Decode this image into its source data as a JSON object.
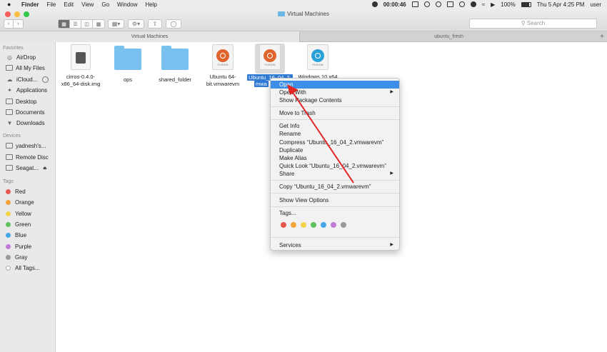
{
  "menubar": {
    "apple": "",
    "app": "Finder",
    "items": [
      "File",
      "Edit",
      "View",
      "Go",
      "Window",
      "Help"
    ],
    "recording_time": "00:00:46",
    "battery": "100%",
    "datetime": "Thu 5 Apr  4:25 PM",
    "user": "user"
  },
  "window": {
    "title": "Virtual Machines",
    "search_placeholder": "Search"
  },
  "tabs": {
    "active": "Virtual Machines",
    "inactive": "ubuntu_fresh",
    "plus": "+"
  },
  "sidebar": {
    "favorites_header": "Favorites",
    "favorites": [
      "AirDrop",
      "All My Files",
      "iCloud...",
      "Applications",
      "Desktop",
      "Documents",
      "Downloads"
    ],
    "devices_header": "Devices",
    "devices": [
      "yadnesh's...",
      "Remote Disc",
      "Seagat..."
    ],
    "tags_header": "Tags",
    "tags": [
      {
        "label": "Red",
        "color": "#e8574e"
      },
      {
        "label": "Orange",
        "color": "#f2a33a"
      },
      {
        "label": "Yellow",
        "color": "#f3d34a"
      },
      {
        "label": "Green",
        "color": "#5fc25a"
      },
      {
        "label": "Blue",
        "color": "#48a6e8"
      },
      {
        "label": "Purple",
        "color": "#c27ad9"
      },
      {
        "label": "Gray",
        "color": "#9a9a9a"
      },
      {
        "label": "All Tags...",
        "color": "#ffffff"
      }
    ]
  },
  "files": [
    {
      "name_l1": "cirros-0.4.0-",
      "name_l2": "x86_64-disk.img",
      "kind": "disk-image"
    },
    {
      "name_l1": "ops",
      "name_l2": "",
      "kind": "folder"
    },
    {
      "name_l1": "shared_folder",
      "name_l2": "",
      "kind": "folder"
    },
    {
      "name_l1": "Ubuntu 64-",
      "name_l2": "bit.vmwarevm",
      "kind": "fusion"
    },
    {
      "name_l1": "Ubuntu_16_04_2.",
      "name_l2": "mwa",
      "kind": "fusion"
    },
    {
      "name_l1": "Windows 10 x64",
      "name_l2": "",
      "kind": "fusion"
    }
  ],
  "fusion_label": "FUSION",
  "context_menu": {
    "items": [
      {
        "label": "Open",
        "highlight": true
      },
      {
        "label": "Open With",
        "submenu": true
      },
      {
        "label": "Show Package Contents"
      },
      {
        "label": "Move to Trash"
      },
      {
        "label": "Get Info"
      },
      {
        "label": "Rename"
      },
      {
        "label": "Compress “Ubuntu_16_04_2.vmwarevm”"
      },
      {
        "label": "Duplicate"
      },
      {
        "label": "Make Alias"
      },
      {
        "label": "Quick Look “Ubuntu_16_04_2.vmwarevm”"
      },
      {
        "label": "Share",
        "submenu": true
      },
      {
        "label": "Copy “Ubuntu_16_04_2.vmwarevm”"
      },
      {
        "label": "Show View Options"
      },
      {
        "label": "Tags..."
      },
      {
        "label": "Services",
        "submenu": true
      }
    ],
    "tag_colors": [
      "#e8574e",
      "#f2a33a",
      "#f3d34a",
      "#5fc25a",
      "#48a6e8",
      "#c27ad9",
      "#9a9a9a"
    ],
    "submenu_arrow": "▶"
  },
  "colors": {
    "highlight": "#3d8ee7",
    "annotation_arrow": "#e02626",
    "ubuntu_orange": "#e2642d",
    "windows_blue": "#2aa0d8"
  }
}
